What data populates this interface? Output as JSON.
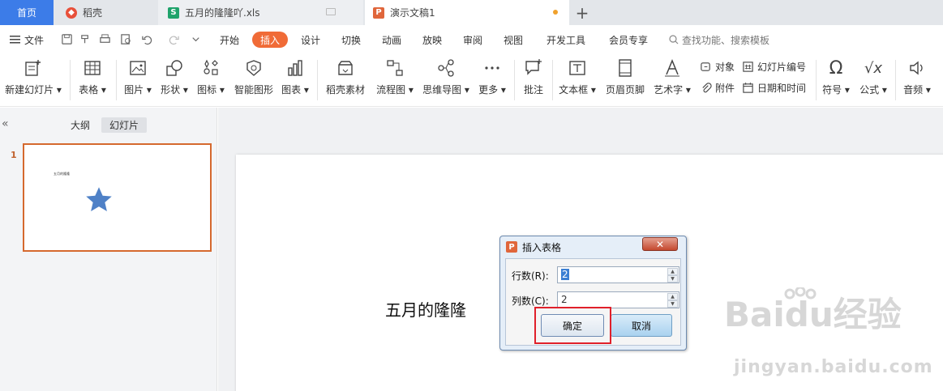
{
  "tabs": {
    "home": "首页",
    "daoke": "稻壳",
    "xls": "五月的隆隆吖.xls",
    "ppt": "演示文稿1",
    "add": "+"
  },
  "menu": {
    "file": "文件",
    "items": [
      "开始",
      "插入",
      "设计",
      "切换",
      "动画",
      "放映",
      "审阅",
      "视图",
      "开发工具",
      "会员专享"
    ],
    "active": "插入",
    "search": "查找功能、搜索模板"
  },
  "ribbon": {
    "new_slide": "新建幻灯片",
    "table": "表格",
    "picture": "图片",
    "shape": "形状",
    "icon": "图标",
    "smart": "智能图形",
    "chart": "图表",
    "daoke_material": "稻壳素材",
    "flowchart": "流程图",
    "mindmap": "思维导图",
    "more": "更多",
    "comment": "批注",
    "textbox": "文本框",
    "header_footer": "页眉页脚",
    "wordart": "艺术字",
    "object": "对象",
    "attachment": "附件",
    "slide_number": "幻灯片编号",
    "datetime": "日期和时间",
    "symbol": "符号",
    "formula": "公式",
    "audio": "音频"
  },
  "panel": {
    "collapse": "«",
    "outline": "大纲",
    "slides": "幻灯片",
    "slide_number": "1",
    "thumb_text": "五月的隆隆"
  },
  "slide": {
    "text": "五月的隆隆"
  },
  "dialog": {
    "title": "插入表格",
    "close": "✕",
    "rows_label": "行数(R):",
    "rows_value": "2",
    "cols_label": "列数(C):",
    "cols_value": "2",
    "ok": "确定",
    "cancel": "取消"
  },
  "watermark": {
    "brand": "Baidu经验",
    "url": "jingyan.baidu.com"
  },
  "colors": {
    "accent": "#f06b37",
    "home_tab": "#3c7ce8",
    "highlight": "#e0202a"
  }
}
